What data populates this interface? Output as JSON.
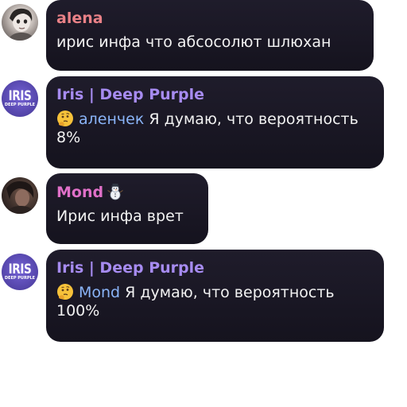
{
  "messages": [
    {
      "author": "alena",
      "text": "ирис инфа что абсосолют шлюхан"
    },
    {
      "author": "Iris | Deep Purple",
      "mention": "аленчек",
      "text": "Я думаю, что вероятность 8%"
    },
    {
      "author": "Mond",
      "text": "Ирис инфа врет"
    },
    {
      "author": "Iris | Deep Purple",
      "mention": "Mond",
      "text": "Я думаю, что вероятность 100%"
    }
  ],
  "iris_logo": {
    "main": "IRIS",
    "sub": "DEEP PURPLE"
  },
  "icons": {
    "thinking_emoji": "thinking-face-icon",
    "snowman_emoji": "snowman-icon"
  },
  "colors": {
    "bubble": "#1a1725",
    "alena_name": "#e98187",
    "iris_name": "#a68bf0",
    "mond_name": "#e070c8",
    "mention": "#8ab4f8",
    "message_text": "#f2f2f2"
  }
}
